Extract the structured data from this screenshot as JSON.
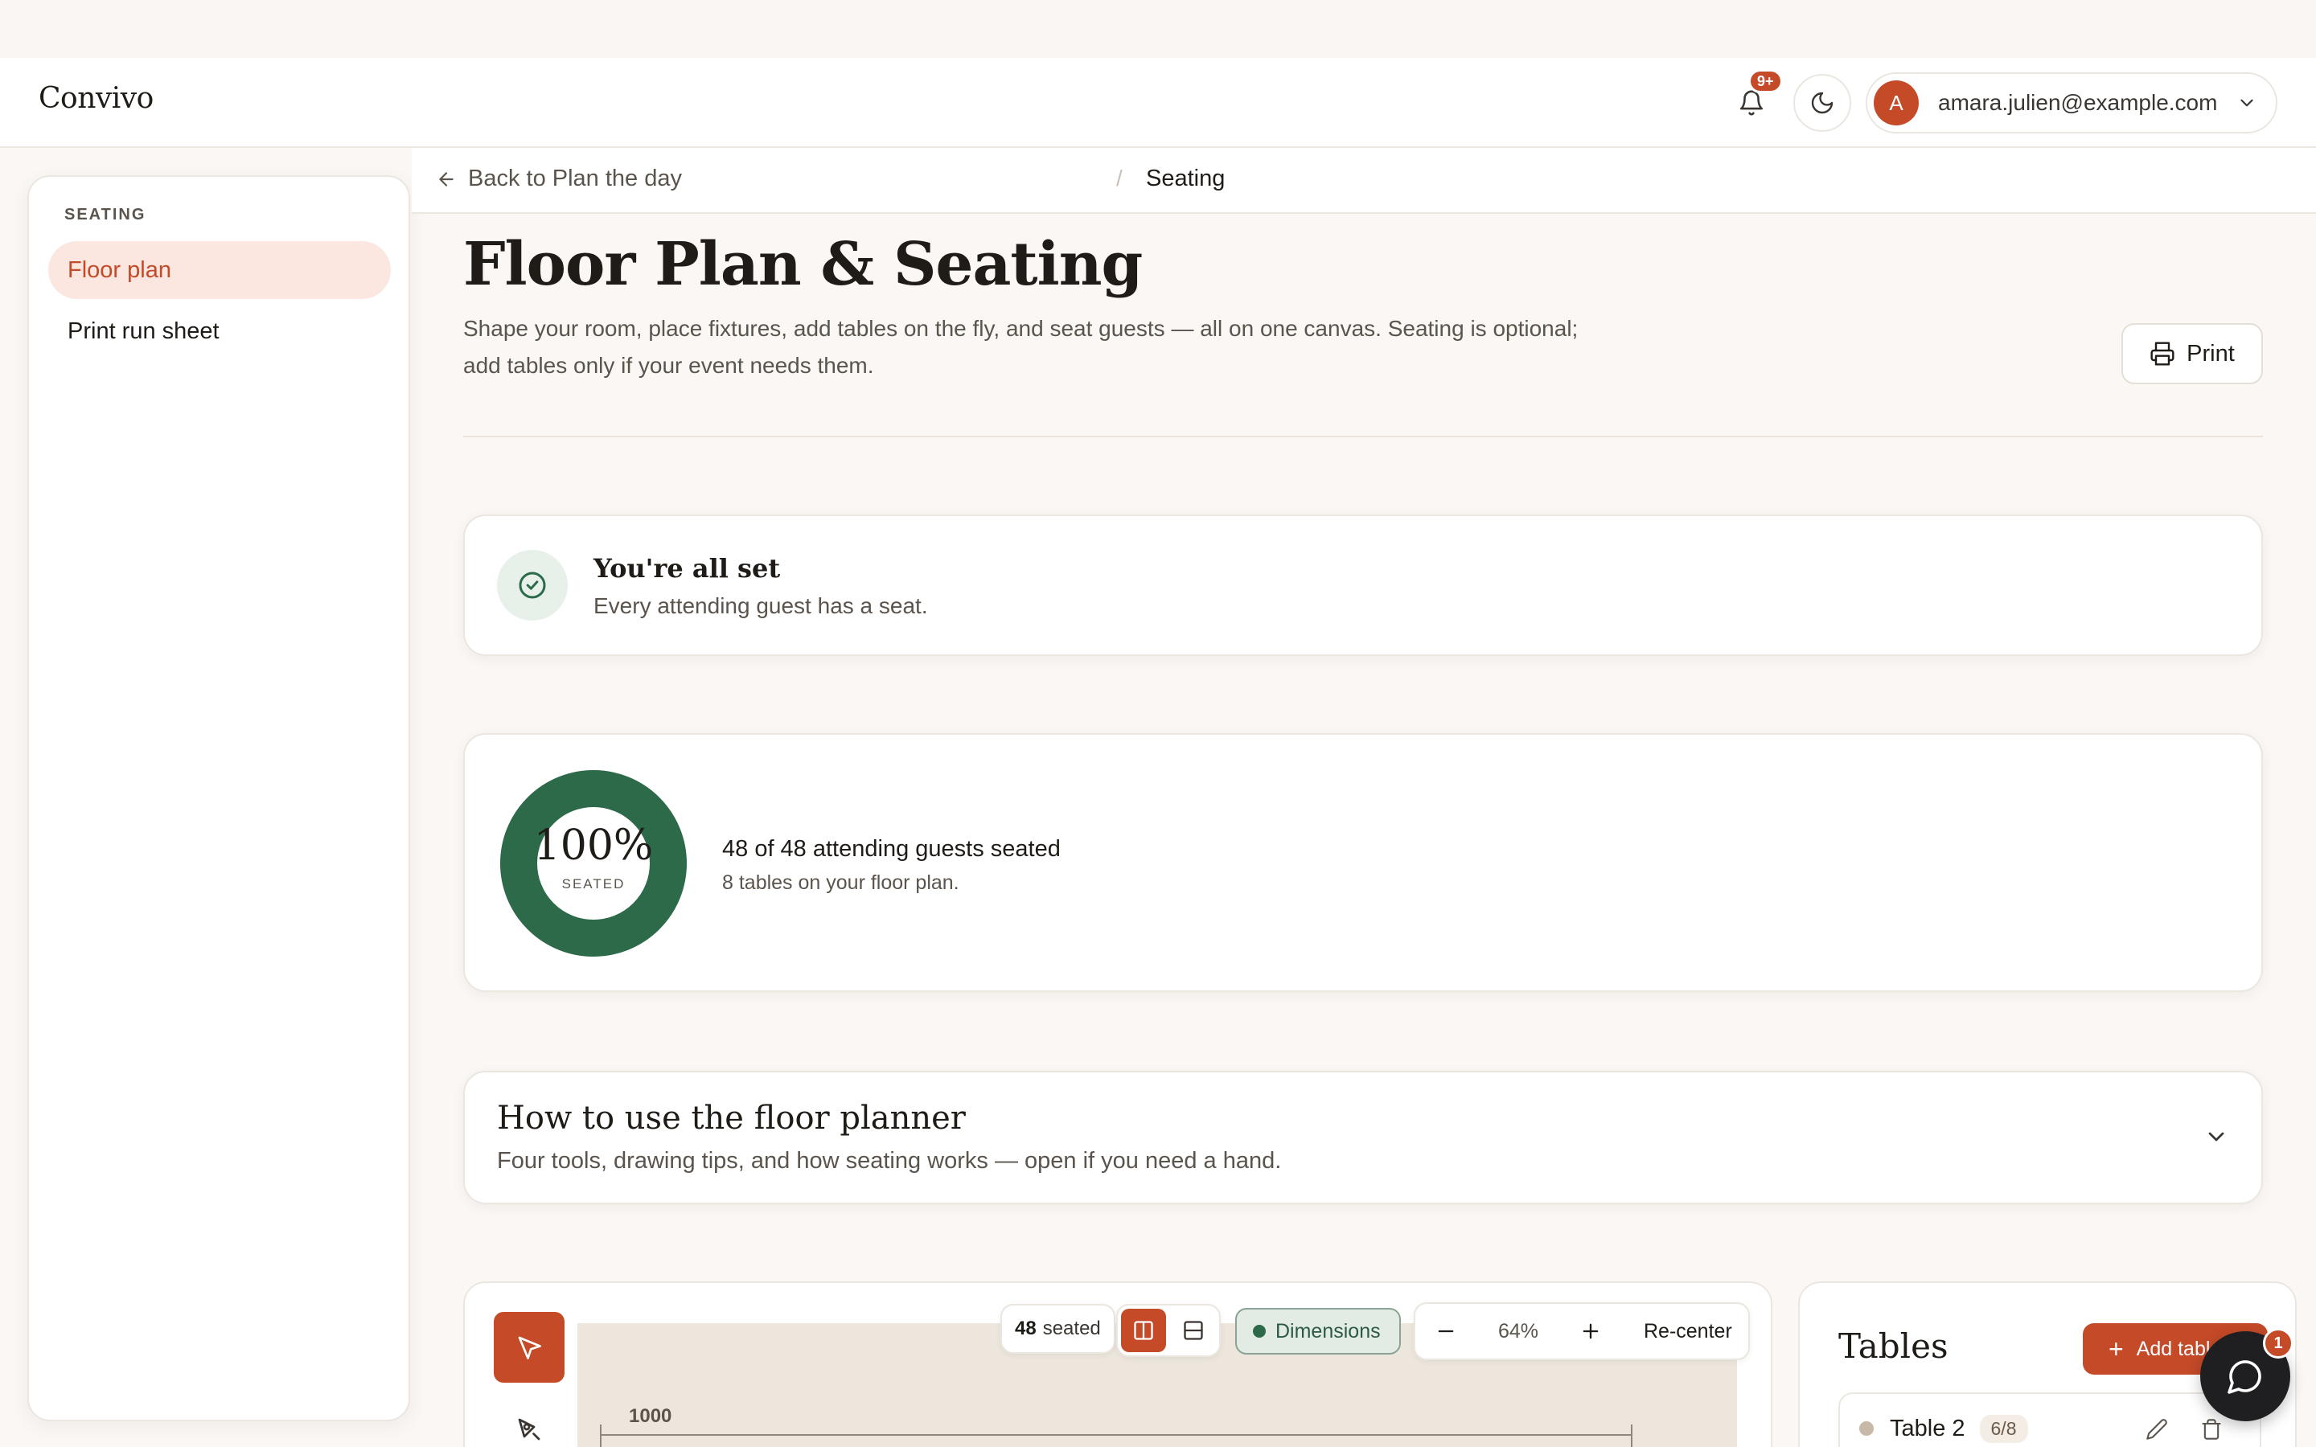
{
  "app": {
    "brand": "Convivo"
  },
  "header": {
    "notifications_badge": "9+",
    "account_initial": "A",
    "account_email": "amara.julien@example.com"
  },
  "sidebar": {
    "section": "SEATING",
    "items": [
      {
        "label": "Floor plan",
        "active": true
      },
      {
        "label": "Print run sheet",
        "active": false
      }
    ]
  },
  "breadcrumb": {
    "back_label": "Back to Plan the day",
    "separator": "/",
    "current": "Seating"
  },
  "page": {
    "title": "Floor Plan & Seating",
    "description": "Shape your room, place fixtures, add tables on the fly, and seat guests — all on one canvas. Seating is optional; add tables only if your event needs them.",
    "print_label": "Print"
  },
  "status_card": {
    "title": "You're all set",
    "subtitle": "Every attending guest has a seat."
  },
  "seating_summary": {
    "percent_label": "100%",
    "percent_value": 1.0,
    "caption": "SEATED",
    "main": "48 of 48 attending guests seated",
    "sub": "8 tables on your floor plan."
  },
  "help": {
    "title": "How to use the floor planner",
    "subtitle": "Four tools, drawing tips, and how seating works — open if you need a hand."
  },
  "canvas": {
    "seated_count": "48",
    "seated_suffix": "seated",
    "dimensions_label": "Dimensions",
    "zoom": "64%",
    "recenter_label": "Re-center",
    "dimension_value": "1000"
  },
  "tables_panel": {
    "title": "Tables",
    "add_label": "Add table",
    "rows": [
      {
        "name": "Table 2",
        "badge": "6/8"
      }
    ]
  },
  "chat": {
    "badge": "1"
  },
  "colors": {
    "accent": "#c44a28",
    "success": "#2d6a4a",
    "background": "#faf7f4"
  }
}
